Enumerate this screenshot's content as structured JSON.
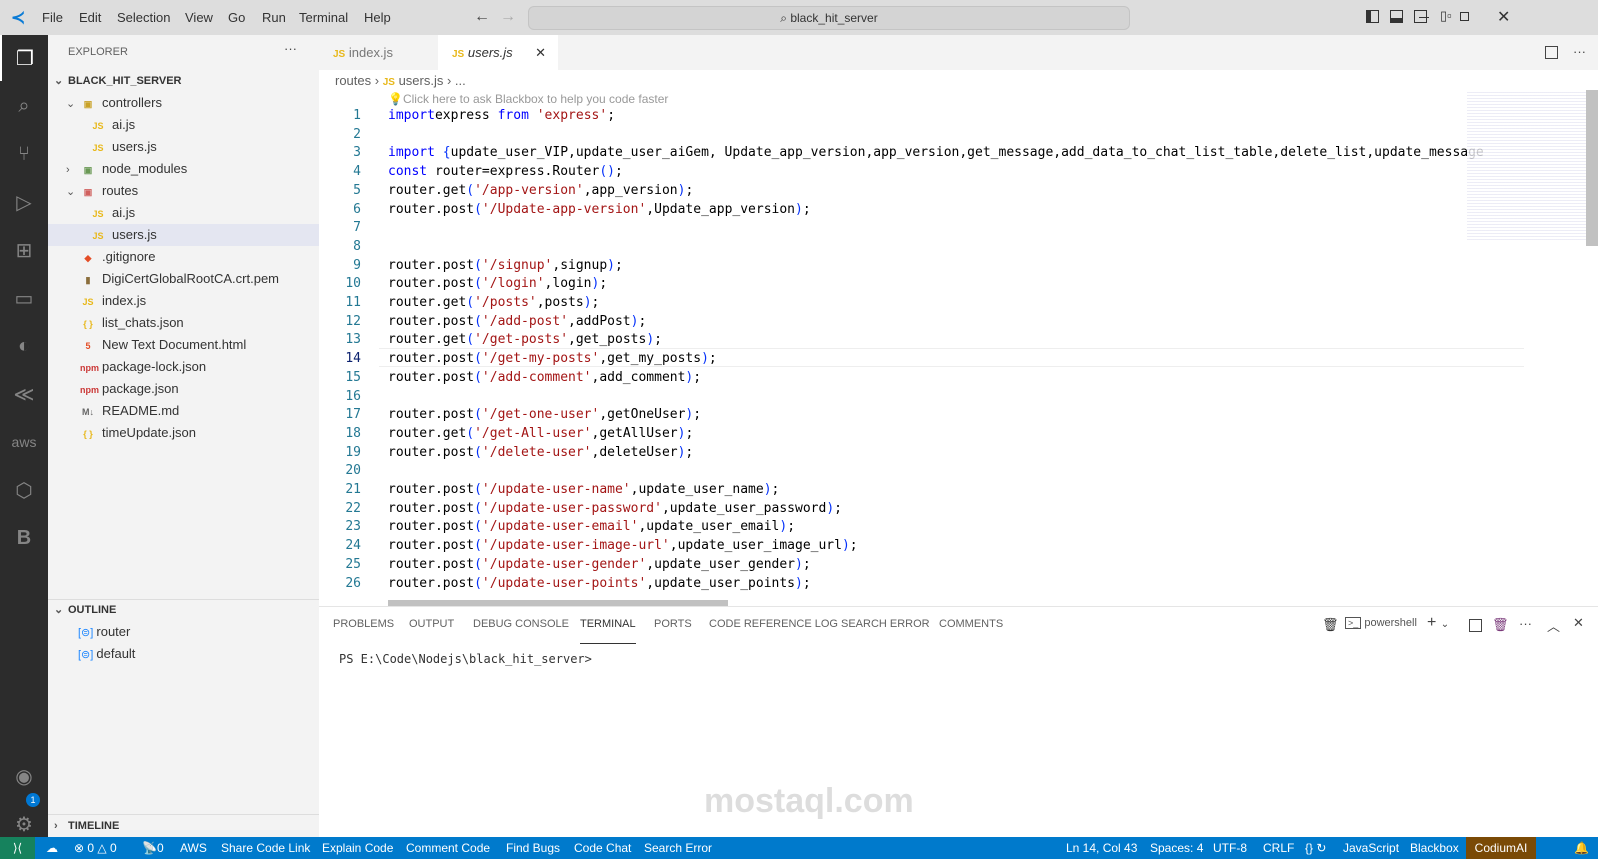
{
  "titlebar": {
    "menus": [
      "File",
      "Edit",
      "Selection",
      "View",
      "Go",
      "Run",
      "Terminal",
      "Help"
    ],
    "search": "black_hit_server"
  },
  "sidebar": {
    "title": "EXPLORER",
    "root": "BLACK_HIT_SERVER",
    "tree": [
      {
        "label": "controllers",
        "icon": "folder-controllers-icon",
        "depth": 1,
        "chev": "open"
      },
      {
        "label": "ai.js",
        "icon": "js",
        "depth": 2
      },
      {
        "label": "users.js",
        "icon": "js",
        "depth": 2
      },
      {
        "label": "node_modules",
        "icon": "folder-node-icon",
        "depth": 1,
        "chev": "closed"
      },
      {
        "label": "routes",
        "icon": "folder-routes-icon",
        "depth": 1,
        "chev": "open"
      },
      {
        "label": "ai.js",
        "icon": "js",
        "depth": 2
      },
      {
        "label": "users.js",
        "icon": "js",
        "depth": 2,
        "selected": true
      },
      {
        "label": ".gitignore",
        "icon": "git",
        "depth": 1
      },
      {
        "label": "DigiCertGlobalRootCA.crt.pem",
        "icon": "cert",
        "depth": 1
      },
      {
        "label": "index.js",
        "icon": "js",
        "depth": 1
      },
      {
        "label": "list_chats.json",
        "icon": "json",
        "depth": 1
      },
      {
        "label": "New Text Document.html",
        "icon": "html",
        "depth": 1
      },
      {
        "label": "package-lock.json",
        "icon": "npm",
        "depth": 1
      },
      {
        "label": "package.json",
        "icon": "npm",
        "depth": 1
      },
      {
        "label": "README.md",
        "icon": "md",
        "depth": 1
      },
      {
        "label": "timeUpdate.json",
        "icon": "json",
        "depth": 1
      }
    ],
    "outline": {
      "title": "OUTLINE",
      "items": [
        "router",
        "default"
      ]
    },
    "timeline": "TIMELINE"
  },
  "tabs": [
    {
      "label": "index.js",
      "icon": "JS"
    },
    {
      "label": "users.js",
      "icon": "JS",
      "active": true
    }
  ],
  "breadcrumb": [
    "routes",
    "users.js",
    "..."
  ],
  "hint": "Click here to ask Blackbox to help you code faster",
  "code": [
    [
      [
        "kw",
        "import"
      ],
      [
        "",
        "express "
      ],
      [
        "kw",
        "from"
      ],
      [
        "",
        ""
      ],
      [
        "str",
        " 'express'"
      ],
      [
        "",
        ";"
      ]
    ],
    [],
    [
      [
        "kw",
        "import"
      ],
      [
        "",
        " "
      ],
      [
        "b1",
        "{"
      ],
      [
        "",
        "update_user_VIP,update_user_aiGem, Update_app_version,app_version,get_message,add_data_to_chat_list_table,delete_list,update_message"
      ]
    ],
    [
      [
        "kw",
        "const"
      ],
      [
        "",
        " router=express.Router"
      ],
      [
        "b1",
        "()"
      ],
      [
        "",
        ";"
      ]
    ],
    [
      [
        "",
        "router.get"
      ],
      [
        "b1",
        "("
      ],
      [
        "str",
        "'/app-version'"
      ],
      [
        "",
        ",app_version"
      ],
      [
        "b1",
        ")"
      ],
      [
        "",
        ";"
      ]
    ],
    [
      [
        "",
        "router.post"
      ],
      [
        "b1",
        "("
      ],
      [
        "str",
        "'/Update-app-version'"
      ],
      [
        "",
        ",Update_app_version"
      ],
      [
        "b1",
        ")"
      ],
      [
        "",
        ";"
      ]
    ],
    [],
    [],
    [
      [
        "",
        "router.post"
      ],
      [
        "b1",
        "("
      ],
      [
        "str",
        "'/signup'"
      ],
      [
        "",
        ",signup"
      ],
      [
        "b1",
        ")"
      ],
      [
        "",
        ";"
      ]
    ],
    [
      [
        "",
        "router.post"
      ],
      [
        "b1",
        "("
      ],
      [
        "str",
        "'/login'"
      ],
      [
        "",
        ",login"
      ],
      [
        "b1",
        ")"
      ],
      [
        "",
        ";"
      ]
    ],
    [
      [
        "",
        "router.get"
      ],
      [
        "b1",
        "("
      ],
      [
        "str",
        "'/posts'"
      ],
      [
        "",
        ",posts"
      ],
      [
        "b1",
        ")"
      ],
      [
        "",
        ";"
      ]
    ],
    [
      [
        "",
        "router.post"
      ],
      [
        "b1",
        "("
      ],
      [
        "str",
        "'/add-post'"
      ],
      [
        "",
        ",addPost"
      ],
      [
        "b1",
        ")"
      ],
      [
        "",
        ";"
      ]
    ],
    [
      [
        "",
        "router.get"
      ],
      [
        "b1",
        "("
      ],
      [
        "str",
        "'/get-posts'"
      ],
      [
        "",
        ",get_posts"
      ],
      [
        "b1",
        ")"
      ],
      [
        "",
        ";"
      ]
    ],
    [
      [
        "",
        "router.post"
      ],
      [
        "b1",
        "("
      ],
      [
        "str",
        "'/get-my-posts'"
      ],
      [
        "",
        ",get_my_posts"
      ],
      [
        "b1",
        ")"
      ],
      [
        "",
        ";"
      ]
    ],
    [
      [
        "",
        "router.post"
      ],
      [
        "b1",
        "("
      ],
      [
        "str",
        "'/add-comment'"
      ],
      [
        "",
        ",add_comment"
      ],
      [
        "b1",
        ")"
      ],
      [
        "",
        ";"
      ]
    ],
    [],
    [
      [
        "",
        "router.post"
      ],
      [
        "b1",
        "("
      ],
      [
        "str",
        "'/get-one-user'"
      ],
      [
        "",
        ",getOneUser"
      ],
      [
        "b1",
        ")"
      ],
      [
        "",
        ";"
      ]
    ],
    [
      [
        "",
        "router.get"
      ],
      [
        "b1",
        "("
      ],
      [
        "str",
        "'/get-All-user'"
      ],
      [
        "",
        ",getAllUser"
      ],
      [
        "b1",
        ")"
      ],
      [
        "",
        ";"
      ]
    ],
    [
      [
        "",
        "router.post"
      ],
      [
        "b1",
        "("
      ],
      [
        "str",
        "'/delete-user'"
      ],
      [
        "",
        ",deleteUser"
      ],
      [
        "b1",
        ")"
      ],
      [
        "",
        ";"
      ]
    ],
    [],
    [
      [
        "",
        "router.post"
      ],
      [
        "b1",
        "("
      ],
      [
        "str",
        "'/update-user-name'"
      ],
      [
        "",
        ",update_user_name"
      ],
      [
        "b1",
        ")"
      ],
      [
        "",
        ";"
      ]
    ],
    [
      [
        "",
        "router.post"
      ],
      [
        "b1",
        "("
      ],
      [
        "str",
        "'/update-user-password'"
      ],
      [
        "",
        ",update_user_password"
      ],
      [
        "b1",
        ")"
      ],
      [
        "",
        ";"
      ]
    ],
    [
      [
        "",
        "router.post"
      ],
      [
        "b1",
        "("
      ],
      [
        "str",
        "'/update-user-email'"
      ],
      [
        "",
        ",update_user_email"
      ],
      [
        "b1",
        ")"
      ],
      [
        "",
        ";"
      ]
    ],
    [
      [
        "",
        "router.post"
      ],
      [
        "b1",
        "("
      ],
      [
        "str",
        "'/update-user-image-url'"
      ],
      [
        "",
        ",update_user_image_url"
      ],
      [
        "b1",
        ")"
      ],
      [
        "",
        ";"
      ]
    ],
    [
      [
        "",
        "router.post"
      ],
      [
        "b1",
        "("
      ],
      [
        "str",
        "'/update-user-gender'"
      ],
      [
        "",
        ",update_user_gender"
      ],
      [
        "b1",
        ")"
      ],
      [
        "",
        ";"
      ]
    ],
    [
      [
        "",
        "router.post"
      ],
      [
        "b1",
        "("
      ],
      [
        "str",
        "'/update-user-points'"
      ],
      [
        "",
        ",update_user_points"
      ],
      [
        "b1",
        ")"
      ],
      [
        "",
        ";"
      ]
    ]
  ],
  "panel": {
    "tabs": [
      "PROBLEMS",
      "OUTPUT",
      "DEBUG CONSOLE",
      "TERMINAL",
      "PORTS",
      "CODE REFERENCE LOG",
      "SEARCH ERROR",
      "COMMENTS"
    ],
    "active": "TERMINAL",
    "shell": "powershell",
    "prompt": "PS E:\\Code\\Nodejs\\black_hit_server>"
  },
  "status": {
    "left": [
      "0",
      "0",
      "0",
      "AWS",
      "Share Code Link",
      "Explain Code",
      "Comment Code",
      "Find Bugs",
      "Code Chat",
      "Search Error"
    ],
    "position": "Ln 14, Col 43",
    "spaces": "Spaces: 4",
    "encoding": "UTF-8",
    "eol": "CRLF",
    "language": "JavaScript",
    "blackbox": "Blackbox",
    "codium": "CodiumAI"
  },
  "watermark": "mostaql.com",
  "badge": "1",
  "colors": {
    "status": "#007acc",
    "codium": "#7a4a06",
    "remote": "#16825d"
  }
}
